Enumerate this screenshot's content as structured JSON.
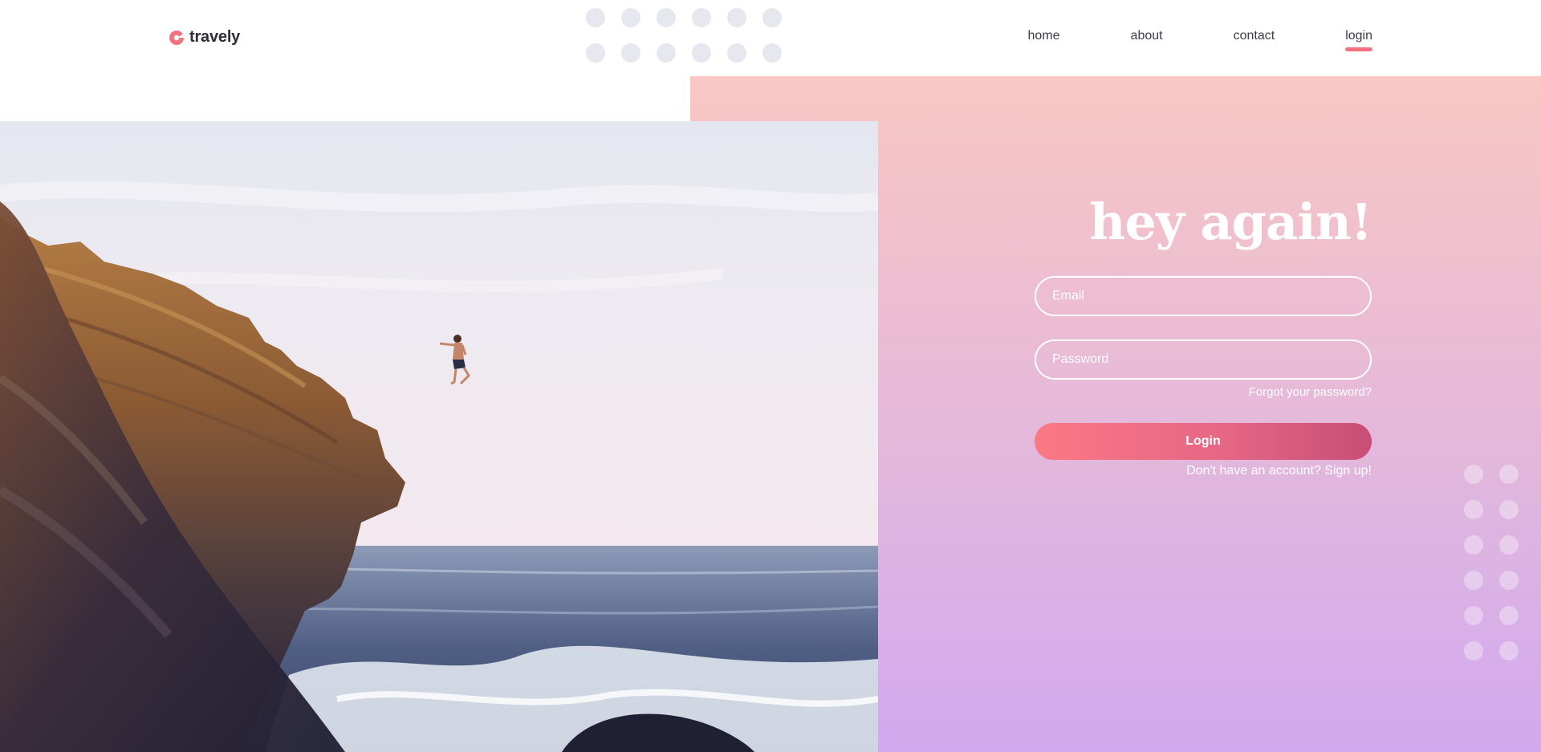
{
  "header": {
    "brand": "travely",
    "nav": [
      {
        "label": "home",
        "active": false
      },
      {
        "label": "about",
        "active": false
      },
      {
        "label": "contact",
        "active": false
      },
      {
        "label": "login",
        "active": true
      }
    ]
  },
  "login": {
    "heading": "hey again!",
    "email_placeholder": "Email",
    "password_placeholder": "Password",
    "forgot_label": "Forgot your password?",
    "login_label": "Login",
    "signup_label": "Don't have an account? Sign up!"
  },
  "colors": {
    "accent": "#f4717f",
    "gradient_top": "#f8c8c3",
    "gradient_bottom": "#d2a9ef",
    "button_start": "#fb7884",
    "button_end": "#c84e77",
    "text_dark": "#3d3d4a"
  },
  "icons": {
    "brand": "travely-logo-icon"
  }
}
